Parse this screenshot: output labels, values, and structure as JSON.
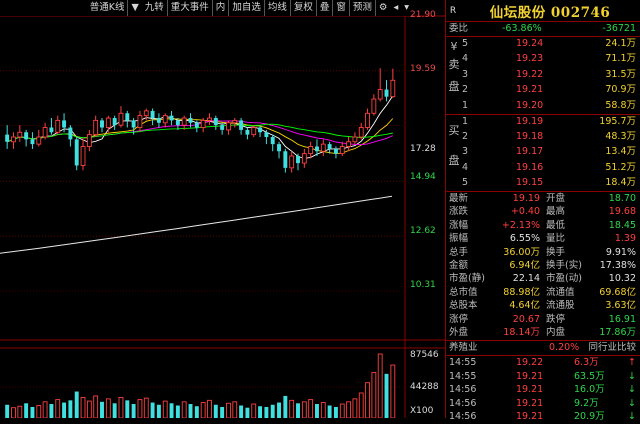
{
  "toolbar": {
    "items": [
      "普通K线",
      "九转",
      "重大事件",
      "内",
      "加自选",
      "均线",
      "复权",
      "叠",
      "窗",
      "预测"
    ]
  },
  "price_axis": [
    "21.90",
    "19.59",
    "17.28",
    "14.94",
    "12.62",
    "10.31"
  ],
  "volume_axis": {
    "top": "87546",
    "mid": "44288",
    "unit": "X100"
  },
  "colors": {
    "up": "#ff4040",
    "down": "#40e0e0",
    "ma1": "#ffffff",
    "ma2": "#ffd700",
    "ma3": "#ff00ff",
    "ma4": "#00ff00",
    "ma250": "#e8e8e8",
    "grid": "#8b0000"
  },
  "chart_data": {
    "type": "candlestick",
    "ylim": [
      10.31,
      21.9
    ],
    "candles": [
      {
        "o": 16.9,
        "c": 16.6,
        "h": 17.3,
        "l": 16.3
      },
      {
        "o": 16.6,
        "c": 16.8,
        "h": 17.0,
        "l": 16.3
      },
      {
        "o": 16.8,
        "c": 17.0,
        "h": 17.3,
        "l": 16.6
      },
      {
        "o": 17.0,
        "c": 16.7,
        "h": 17.1,
        "l": 16.4
      },
      {
        "o": 16.7,
        "c": 16.5,
        "h": 17.0,
        "l": 16.3
      },
      {
        "o": 16.5,
        "c": 16.8,
        "h": 17.1,
        "l": 16.4
      },
      {
        "o": 16.8,
        "c": 17.2,
        "h": 17.4,
        "l": 16.7
      },
      {
        "o": 17.2,
        "c": 17.0,
        "h": 17.6,
        "l": 16.9
      },
      {
        "o": 17.0,
        "c": 17.5,
        "h": 17.7,
        "l": 16.9
      },
      {
        "o": 17.5,
        "c": 17.2,
        "h": 17.8,
        "l": 17.0
      },
      {
        "o": 17.2,
        "c": 16.7,
        "h": 17.3,
        "l": 16.4
      },
      {
        "o": 16.7,
        "c": 15.6,
        "h": 16.8,
        "l": 15.4
      },
      {
        "o": 15.6,
        "c": 16.4,
        "h": 16.7,
        "l": 15.4
      },
      {
        "o": 16.4,
        "c": 16.9,
        "h": 17.1,
        "l": 16.2
      },
      {
        "o": 16.9,
        "c": 17.5,
        "h": 17.7,
        "l": 16.8
      },
      {
        "o": 17.5,
        "c": 17.2,
        "h": 17.6,
        "l": 17.0
      },
      {
        "o": 17.2,
        "c": 17.6,
        "h": 17.7,
        "l": 17.0
      },
      {
        "o": 17.6,
        "c": 17.3,
        "h": 17.7,
        "l": 17.1
      },
      {
        "o": 17.3,
        "c": 17.8,
        "h": 18.1,
        "l": 17.2
      },
      {
        "o": 17.8,
        "c": 17.5,
        "h": 17.9,
        "l": 17.2
      },
      {
        "o": 17.5,
        "c": 17.2,
        "h": 17.6,
        "l": 16.9
      },
      {
        "o": 17.2,
        "c": 17.7,
        "h": 17.9,
        "l": 17.0
      },
      {
        "o": 17.7,
        "c": 17.9,
        "h": 18.0,
        "l": 17.5
      },
      {
        "o": 17.9,
        "c": 17.6,
        "h": 18.0,
        "l": 17.3
      },
      {
        "o": 17.6,
        "c": 17.4,
        "h": 17.8,
        "l": 17.2
      },
      {
        "o": 17.4,
        "c": 17.7,
        "h": 17.8,
        "l": 17.2
      },
      {
        "o": 17.7,
        "c": 17.5,
        "h": 17.9,
        "l": 17.3
      },
      {
        "o": 17.5,
        "c": 17.3,
        "h": 17.6,
        "l": 17.1
      },
      {
        "o": 17.3,
        "c": 17.6,
        "h": 17.7,
        "l": 17.1
      },
      {
        "o": 17.6,
        "c": 17.4,
        "h": 17.8,
        "l": 17.2
      },
      {
        "o": 17.4,
        "c": 17.2,
        "h": 17.5,
        "l": 17.0
      },
      {
        "o": 17.2,
        "c": 17.5,
        "h": 17.6,
        "l": 17.0
      },
      {
        "o": 17.5,
        "c": 17.6,
        "h": 17.8,
        "l": 17.3
      },
      {
        "o": 17.6,
        "c": 17.3,
        "h": 17.7,
        "l": 17.1
      },
      {
        "o": 17.3,
        "c": 17.1,
        "h": 17.4,
        "l": 16.9
      },
      {
        "o": 17.1,
        "c": 17.4,
        "h": 17.5,
        "l": 16.9
      },
      {
        "o": 17.4,
        "c": 17.5,
        "h": 17.6,
        "l": 17.2
      },
      {
        "o": 17.5,
        "c": 17.1,
        "h": 17.6,
        "l": 16.9
      },
      {
        "o": 17.1,
        "c": 16.9,
        "h": 17.2,
        "l": 16.7
      },
      {
        "o": 16.9,
        "c": 17.2,
        "h": 17.3,
        "l": 16.8
      },
      {
        "o": 17.2,
        "c": 17.0,
        "h": 17.3,
        "l": 16.8
      },
      {
        "o": 17.0,
        "c": 16.8,
        "h": 17.1,
        "l": 16.5
      },
      {
        "o": 16.8,
        "c": 16.5,
        "h": 16.9,
        "l": 16.2
      },
      {
        "o": 16.5,
        "c": 16.2,
        "h": 16.6,
        "l": 15.9
      },
      {
        "o": 16.2,
        "c": 15.5,
        "h": 16.3,
        "l": 15.3
      },
      {
        "o": 15.5,
        "c": 16.0,
        "h": 16.2,
        "l": 15.3
      },
      {
        "o": 16.0,
        "c": 15.7,
        "h": 16.1,
        "l": 15.4
      },
      {
        "o": 15.7,
        "c": 16.1,
        "h": 16.3,
        "l": 15.5
      },
      {
        "o": 16.1,
        "c": 16.4,
        "h": 16.6,
        "l": 15.9
      },
      {
        "o": 16.4,
        "c": 16.2,
        "h": 16.7,
        "l": 16.0
      },
      {
        "o": 16.2,
        "c": 16.5,
        "h": 16.7,
        "l": 16.0
      },
      {
        "o": 16.5,
        "c": 16.3,
        "h": 16.6,
        "l": 16.1
      },
      {
        "o": 16.3,
        "c": 16.1,
        "h": 16.4,
        "l": 15.9
      },
      {
        "o": 16.1,
        "c": 16.4,
        "h": 16.6,
        "l": 16.0
      },
      {
        "o": 16.4,
        "c": 16.6,
        "h": 16.8,
        "l": 16.2
      },
      {
        "o": 16.6,
        "c": 16.8,
        "h": 17.0,
        "l": 16.5
      },
      {
        "o": 16.8,
        "c": 17.2,
        "h": 17.4,
        "l": 16.7
      },
      {
        "o": 17.2,
        "c": 17.8,
        "h": 18.0,
        "l": 17.1
      },
      {
        "o": 17.8,
        "c": 18.4,
        "h": 18.6,
        "l": 17.7
      },
      {
        "o": 18.4,
        "c": 18.8,
        "h": 19.7,
        "l": 18.3
      },
      {
        "o": 18.8,
        "c": 18.5,
        "h": 19.2,
        "l": 18.3
      },
      {
        "o": 18.5,
        "c": 19.19,
        "h": 19.68,
        "l": 18.45
      }
    ],
    "volume": [
      18,
      14,
      16,
      20,
      15,
      17,
      22,
      19,
      25,
      21,
      24,
      36,
      28,
      23,
      30,
      22,
      26,
      20,
      28,
      24,
      19,
      25,
      27,
      21,
      18,
      23,
      20,
      17,
      22,
      19,
      16,
      21,
      24,
      18,
      15,
      20,
      22,
      17,
      14,
      19,
      16,
      15,
      18,
      21,
      30,
      24,
      20,
      22,
      25,
      19,
      21,
      17,
      15,
      19,
      22,
      26,
      34,
      48,
      62,
      87,
      60,
      72
    ],
    "ma250": {
      "start": 11.9,
      "end": 14.3
    },
    "volume_ylim": [
      0,
      87546
    ]
  },
  "header": {
    "r_label": "R",
    "title": "仙坛股份 002746"
  },
  "weibi": {
    "label": "委比",
    "value": "-63.86%",
    "value2": "-36721"
  },
  "sell_side_label": [
    "¥",
    "卖",
    "盘"
  ],
  "buy_side_label": [
    "买",
    "盘"
  ],
  "sell": [
    {
      "n": "5",
      "price": "19.24",
      "vol": "24.1万"
    },
    {
      "n": "4",
      "price": "19.23",
      "vol": "71.1万"
    },
    {
      "n": "3",
      "price": "19.22",
      "vol": "31.5万"
    },
    {
      "n": "2",
      "price": "19.21",
      "vol": "70.9万"
    },
    {
      "n": "1",
      "price": "19.20",
      "vol": "58.8万"
    }
  ],
  "buy": [
    {
      "n": "1",
      "price": "19.19",
      "vol": "195.7万"
    },
    {
      "n": "2",
      "price": "19.18",
      "vol": "48.3万"
    },
    {
      "n": "3",
      "price": "19.17",
      "vol": "13.4万"
    },
    {
      "n": "4",
      "price": "19.16",
      "vol": "51.2万"
    },
    {
      "n": "5",
      "price": "19.15",
      "vol": "18.4万"
    }
  ],
  "stats": [
    {
      "l1": "最新",
      "v1": "19.19",
      "c1": "red",
      "l2": "开盘",
      "v2": "18.70",
      "c2": "grn"
    },
    {
      "l1": "涨跌",
      "v1": "+0.40",
      "c1": "red",
      "l2": "最高",
      "v2": "19.68",
      "c2": "red"
    },
    {
      "l1": "涨幅",
      "v1": "+2.13%",
      "c1": "red",
      "l2": "最低",
      "v2": "18.45",
      "c2": "grn"
    },
    {
      "l1": "振幅",
      "v1": "6.55%",
      "c1": "wht",
      "l2": "量比",
      "v2": "1.39",
      "c2": "red"
    },
    {
      "l1": "总手",
      "v1": "36.00万",
      "c1": "yel",
      "l2": "换手",
      "v2": "9.91%",
      "c2": "wht"
    },
    {
      "l1": "金额",
      "v1": "6.94亿",
      "c1": "yel",
      "l2": "换手(实)",
      "v2": "17.38%",
      "c2": "wht"
    },
    {
      "l1": "市盈(静)",
      "v1": "22.14",
      "c1": "wht",
      "l2": "市盈(动)",
      "v2": "10.32",
      "c2": "wht"
    },
    {
      "l1": "总市值",
      "v1": "88.98亿",
      "c1": "yel",
      "l2": "流通值",
      "v2": "69.68亿",
      "c2": "yel"
    },
    {
      "l1": "总股本",
      "v1": "4.64亿",
      "c1": "yel",
      "l2": "流通股",
      "v2": "3.63亿",
      "c2": "yel"
    },
    {
      "l1": "涨停",
      "v1": "20.67",
      "c1": "red",
      "l2": "跌停",
      "v2": "16.91",
      "c2": "grn"
    },
    {
      "l1": "外盘",
      "v1": "18.14万",
      "c1": "red",
      "l2": "内盘",
      "v2": "17.86万",
      "c2": "grn"
    }
  ],
  "sector": {
    "name": "养殖业",
    "change": "0.20%",
    "compare": "同行业比较"
  },
  "ticks": [
    {
      "time": "14:55",
      "price": "19.22",
      "vol": "6.3万",
      "dir": "↑"
    },
    {
      "time": "14:55",
      "price": "19.21",
      "vol": "63.5万",
      "dir": "↓"
    },
    {
      "time": "14:56",
      "price": "19.21",
      "vol": "16.0万",
      "dir": "↓"
    },
    {
      "time": "14:56",
      "price": "19.21",
      "vol": "9.2万",
      "dir": "↓"
    },
    {
      "time": "14:56",
      "price": "19.21",
      "vol": "20.9万",
      "dir": "↓"
    }
  ]
}
